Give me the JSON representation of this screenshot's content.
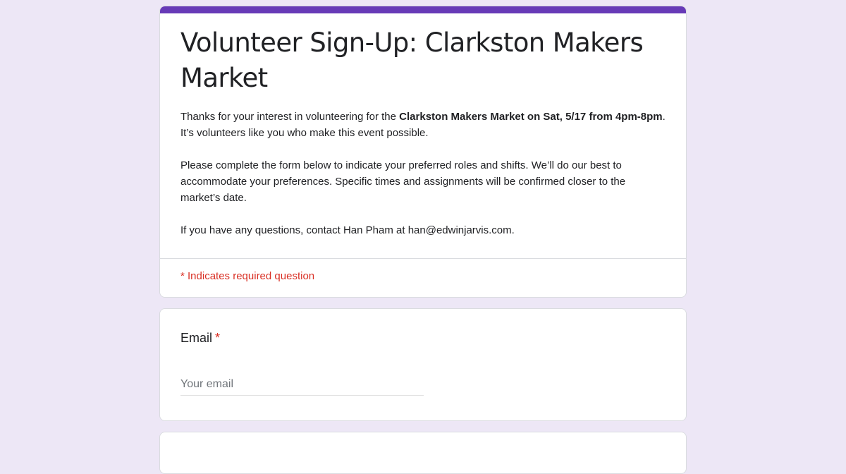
{
  "accent_color": "#673ab7",
  "background_color": "#ede7f6",
  "required_color": "#d93025",
  "header": {
    "title": "Volunteer Sign-Up: Clarkston Makers Market",
    "description": {
      "p1_before": "Thanks for your interest in volunteering for the ",
      "p1_bold": "Clarkston Makers Market on Sat, 5/17 from 4pm-8pm",
      "p1_after": ". It’s volunteers like you who make this event possible.",
      "p2": "Please complete the form below to indicate your preferred roles and shifts. We’ll do our best to accommodate your preferences. Specific times and assignments will be confirmed closer to the market’s date.",
      "p3": "If you have any questions, contact Han Pham at han@edwinjarvis.com."
    },
    "required_note": "* Indicates required question"
  },
  "email_question": {
    "label": "Email",
    "required_marker": "*",
    "placeholder": "Your email",
    "value": ""
  }
}
